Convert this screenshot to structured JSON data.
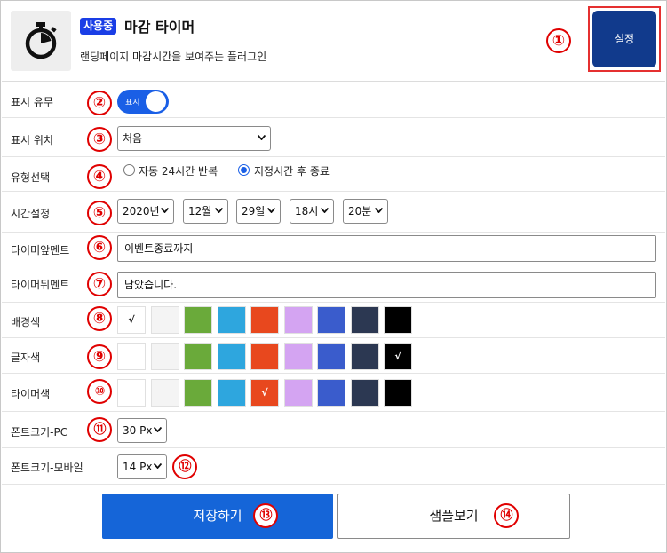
{
  "header": {
    "badge": "사용중",
    "title": "마감 타이머",
    "description": "랜딩페이지 마감시간을 보여주는 플러그인",
    "settings_label": "설정",
    "logo_icon": "stopwatch-icon"
  },
  "markers": [
    "①",
    "②",
    "③",
    "④",
    "⑤",
    "⑥",
    "⑦",
    "⑧",
    "⑨",
    "⑩",
    "⑪",
    "⑫",
    "⑬",
    "⑭"
  ],
  "display": {
    "label": "표시 유무",
    "toggle_text": "표시",
    "on": true
  },
  "position": {
    "label": "표시 위치",
    "value": "처음"
  },
  "type_select": {
    "label": "유형선택",
    "options": [
      {
        "label": "자동 24시간 반복",
        "checked": false
      },
      {
        "label": "지정시간 후 종료",
        "checked": true
      }
    ]
  },
  "time": {
    "label": "시간설정",
    "year": "2020년",
    "month": "12월",
    "day": "29일",
    "hour": "18시",
    "minute": "20분"
  },
  "pre_text": {
    "label": "타이머앞멘트",
    "value": "이벤트종료까지"
  },
  "post_text": {
    "label": "타이머뒤멘트",
    "value": "남았습니다."
  },
  "palette": [
    "#ffffff",
    "#f4f4f4",
    "#6aaa3a",
    "#2ea6de",
    "#e8481e",
    "#d4a4f2",
    "#3a5ccc",
    "#2c3852",
    "#000000"
  ],
  "check_mark": "√",
  "bg_color": {
    "label": "배경색",
    "selected_index": 0
  },
  "text_color": {
    "label": "글자색",
    "selected_index": 8
  },
  "timer_color": {
    "label": "타이머색",
    "selected_index": 4
  },
  "font_pc": {
    "label": "폰트크기-PC",
    "value": "30 Px"
  },
  "font_mobile": {
    "label": "폰트크기-모바일",
    "value": "14 Px"
  },
  "buttons": {
    "save": "저장하기",
    "preview": "샘플보기"
  }
}
